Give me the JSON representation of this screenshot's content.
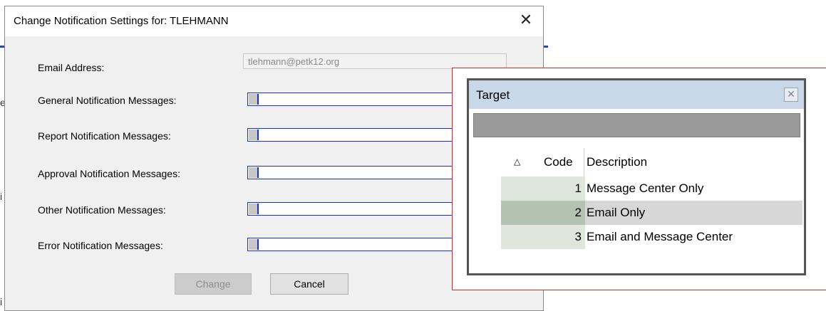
{
  "dialog": {
    "title": "Change Notification Settings for: TLEHMANN",
    "close_glyph": "✕",
    "email_label": "Email Address:",
    "email_value": "tlehmann@petk12.org",
    "fields": [
      {
        "label": "General Notification Messages:"
      },
      {
        "label": "Report Notification Messages:"
      },
      {
        "label": "Approval Notification Messages:"
      },
      {
        "label": "Other Notification Messages:"
      },
      {
        "label": "Error Notification Messages:"
      }
    ],
    "change_label": "Change",
    "cancel_label": "Cancel"
  },
  "background": {
    "fragments": [
      "e",
      "i",
      "i"
    ]
  },
  "popup": {
    "title": "Target",
    "close_glyph": "✕",
    "sort_icon": "△",
    "columns": {
      "code": "Code",
      "description": "Description"
    },
    "rows": [
      {
        "code": "1",
        "description": "Message Center Only"
      },
      {
        "code": "2",
        "description": "Email Only"
      },
      {
        "code": "3",
        "description": "Email and Message Center"
      }
    ],
    "selected_row_index": 1
  },
  "colors": {
    "callout_border": "#d6272b",
    "combo_border": "#1f2fbf",
    "popup_title_bg": "#c9d8e8",
    "selected_row": "#d7d7d7"
  }
}
